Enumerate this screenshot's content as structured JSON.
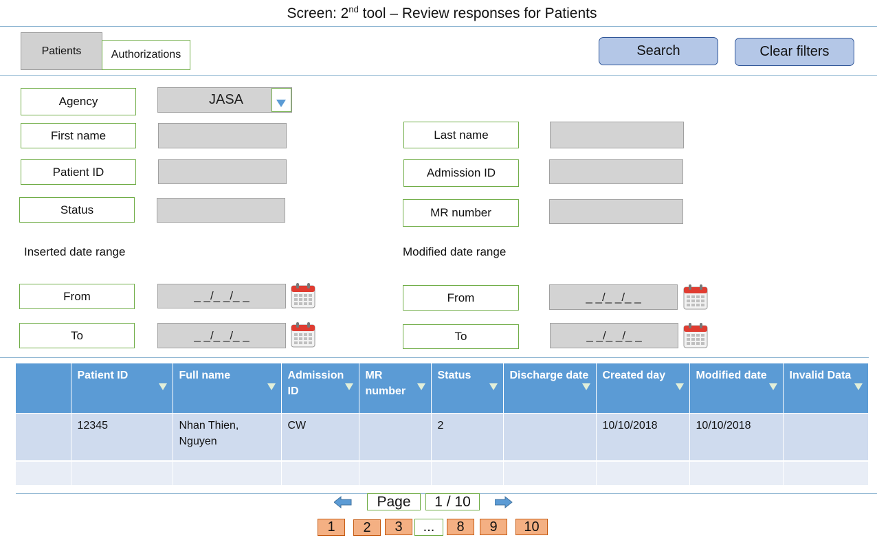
{
  "screen": {
    "title_prefix": "Screen: 2",
    "title_sup": "nd",
    "title_suffix": " tool – Review responses for Patients"
  },
  "tabs": [
    {
      "label": "Patients",
      "active": true
    },
    {
      "label": "Authorizations",
      "active": false
    }
  ],
  "actions": {
    "search": "Search",
    "clear": "Clear filters"
  },
  "filters": {
    "agency_label": "Agency",
    "agency_value": "JASA",
    "first_name_label": "First name",
    "first_name_value": "",
    "last_name_label": "Last name",
    "last_name_value": "",
    "patient_id_label": "Patient ID",
    "patient_id_value": "",
    "admission_id_label": "Admission ID",
    "admission_id_value": "",
    "status_label": "Status",
    "status_value": "",
    "mr_number_label": "MR number",
    "mr_number_value": "",
    "inserted_range_label": "Inserted date range",
    "modified_range_label": "Modified date range",
    "inserted_from_label": "From",
    "inserted_from_value": "_ _/_ _/_ _",
    "inserted_to_label": "To",
    "inserted_to_value": "_ _/_ _/_ _",
    "modified_from_label": "From",
    "modified_from_value": "_ _/_ _/_ _",
    "modified_to_label": "To",
    "modified_to_value": "_ _/_ _/_ _"
  },
  "table": {
    "columns": [
      "",
      "Patient ID",
      "Full name",
      "Admission ID",
      "MR number",
      "Status",
      "Discharge date",
      "Created day",
      "Modified date",
      "Invalid Data"
    ],
    "rows": [
      [
        "",
        "12345",
        "Nhan Thien, Nguyen",
        "CW",
        "",
        "2",
        "",
        "10/10/2018",
        "10/10/2018",
        ""
      ],
      [
        "",
        "",
        "",
        "",
        "",
        "",
        "",
        "",
        "",
        ""
      ]
    ]
  },
  "pager": {
    "page_label": "Page",
    "page_value": "1 / 10",
    "pages": [
      "1",
      "2",
      "3",
      "...",
      "8",
      "9",
      "10"
    ]
  },
  "colors": {
    "header_blue": "#5b9bd5",
    "button_blue": "#b4c7e7",
    "page_orange": "#f4b083",
    "label_border_green": "#70ad47",
    "calendar_red": "#e03c31"
  }
}
